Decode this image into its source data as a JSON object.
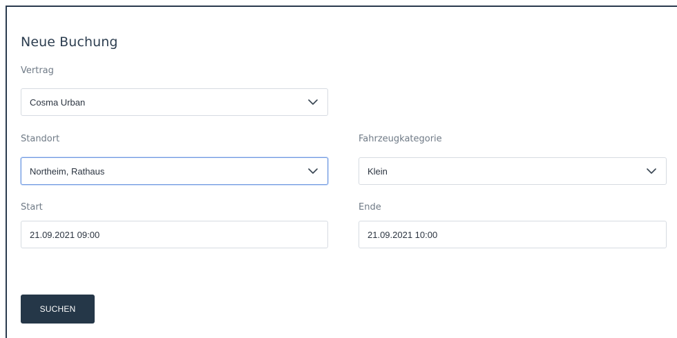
{
  "form": {
    "title": "Neue Buchung",
    "contract": {
      "label": "Vertrag",
      "value": "Cosma Urban",
      "icon": "chevron-down-icon"
    },
    "location": {
      "label": "Standort",
      "value": "Northeim, Rathaus",
      "icon": "chevron-down-icon"
    },
    "vehicle_category": {
      "label": "Fahrzeugkategorie",
      "value": "Klein",
      "icon": "chevron-down-icon"
    },
    "start": {
      "label": "Start",
      "value": "21.09.2021 09:00"
    },
    "end": {
      "label": "Ende",
      "value": "21.09.2021 10:00"
    },
    "submit_label": "SUCHEN"
  },
  "colors": {
    "frame": "#28394d",
    "button": "#253748",
    "focus_border": "#6f98e0",
    "field_border": "#d6dbe1"
  }
}
